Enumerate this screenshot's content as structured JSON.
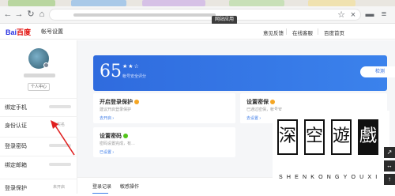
{
  "browser": {
    "tooltip": "网站应用"
  },
  "header": {
    "logo_bai": "Bai",
    "logo_du": "百度",
    "subtitle": "帐号设置",
    "links": [
      "意见反馈",
      "在线客服",
      "百度首页"
    ]
  },
  "sidebar": {
    "personal_center": "个人中心",
    "items": [
      {
        "label": "绑定手机",
        "status": ""
      },
      {
        "label": "身份认证",
        "status": "未实名"
      },
      {
        "label": "登录密码",
        "status": ""
      },
      {
        "label": "绑定邮箱",
        "status": ""
      },
      {
        "label": "登录保护",
        "status": "未开启"
      }
    ]
  },
  "score": {
    "value": "65",
    "stars": "★★☆",
    "caption": "帐号安全评分",
    "detect_label": "检测"
  },
  "cards": [
    {
      "title": "开启登录保护",
      "desc": "建议开启登录保护",
      "link": "去开启 ›",
      "status_color": "#f5a623"
    },
    {
      "title": "设置密保",
      "desc": "已通过密保，帐号安",
      "link": "去设置 ›",
      "status_color": "#f5a623"
    },
    {
      "title": "设置密码",
      "desc": "密码设置完成，有…",
      "link": "已设置 ›",
      "status_color": "#52c41a"
    }
  ],
  "tabs": [
    "登录记录",
    "敏感操作"
  ],
  "watermark": {
    "chars": [
      "深",
      "空",
      "遊",
      "戲"
    ],
    "latin": "SHENKONGYOUXI"
  },
  "colors": {
    "accent": "#2f6bde",
    "link": "#3f7de8",
    "annotation_arrow": "#e02020"
  },
  "icons": [
    "back-icon",
    "forward-icon",
    "refresh-icon",
    "home-icon",
    "star-icon",
    "close-icon",
    "collections-icon",
    "menu-icon"
  ]
}
